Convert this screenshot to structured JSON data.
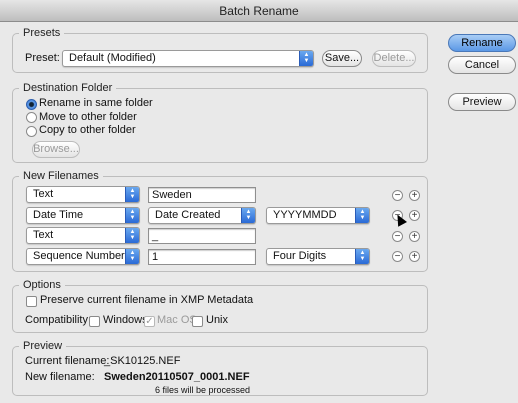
{
  "window": {
    "title": "Batch Rename"
  },
  "presets": {
    "group_label": "Presets",
    "preset_label": "Preset:",
    "preset_value": "Default (Modified)",
    "save_label": "Save...",
    "delete_label": "Delete..."
  },
  "actions": {
    "rename_label": "Rename",
    "cancel_label": "Cancel",
    "preview_label": "Preview"
  },
  "destination": {
    "group_label": "Destination Folder",
    "options": [
      {
        "label": "Rename in same folder",
        "selected": true
      },
      {
        "label": "Move to other folder",
        "selected": false
      },
      {
        "label": "Copy to other folder",
        "selected": false
      }
    ],
    "browse_label": "Browse..."
  },
  "new_filenames": {
    "group_label": "New Filenames",
    "rows": [
      {
        "type": "Text",
        "value": "Sweden"
      },
      {
        "type": "Date Time",
        "source": "Date Created",
        "format": "YYYYMMDD"
      },
      {
        "type": "Text",
        "value": "_"
      },
      {
        "type": "Sequence Number",
        "value": "1",
        "digits": "Four Digits"
      }
    ],
    "minus_glyph": "−",
    "plus_glyph": "+"
  },
  "options": {
    "group_label": "Options",
    "preserve_label": "Preserve current filename in XMP Metadata",
    "preserve_checked": false,
    "compat_label": "Compatibility:",
    "windows_label": "Windows",
    "windows_checked": false,
    "macos_label": "Mac OS",
    "macos_checked": true,
    "unix_label": "Unix",
    "unix_checked": false,
    "check_glyph": "✓"
  },
  "preview": {
    "group_label": "Preview",
    "current_label": "Current filename:",
    "current_value": "_SK10125.NEF",
    "new_label": "New filename:",
    "new_value": "Sweden20110507_0001.NEF",
    "count_text": "6 files will be processed"
  },
  "icons": {
    "popup_arrows": "▲▼",
    "selected_color": "#3a78d8"
  }
}
